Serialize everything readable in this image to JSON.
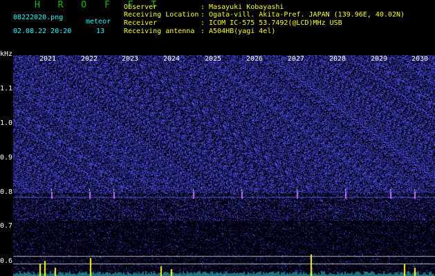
{
  "header": {
    "app_title": "H R O F F T",
    "filename": "08222020.png",
    "meteor_label": "meteor",
    "datetime": "02.08.22 20:20",
    "meteor_count": "13"
  },
  "info": {
    "labels": [
      "Observer",
      "Receiving Location",
      "Receiver",
      "Receiving antenna"
    ],
    "values": [
      ": Masayuki Kobayashi",
      ": Ogata-vill. Akita-Pref. JAPAN (139.96E, 40.02N)",
      ": ICOM IC-575 53.7492(@LCD)MHz USB",
      ": A504HB(yagi 4el)"
    ]
  },
  "axis": {
    "unit": "kHz",
    "y_ticks": [
      "1.1",
      "1.0",
      "0.9",
      "0.8",
      "0.7",
      "0.6"
    ],
    "x_ticks": [
      "2021",
      "2022",
      "2023",
      "2024",
      "2025",
      "2026",
      "2027",
      "2028",
      "2029",
      "2030"
    ]
  },
  "colors": {
    "background": "#000000",
    "title": "#00c000",
    "label": "#ffff00",
    "value": "#00ffff",
    "noise": "#2828a8",
    "meteor": "#ffff00"
  }
}
